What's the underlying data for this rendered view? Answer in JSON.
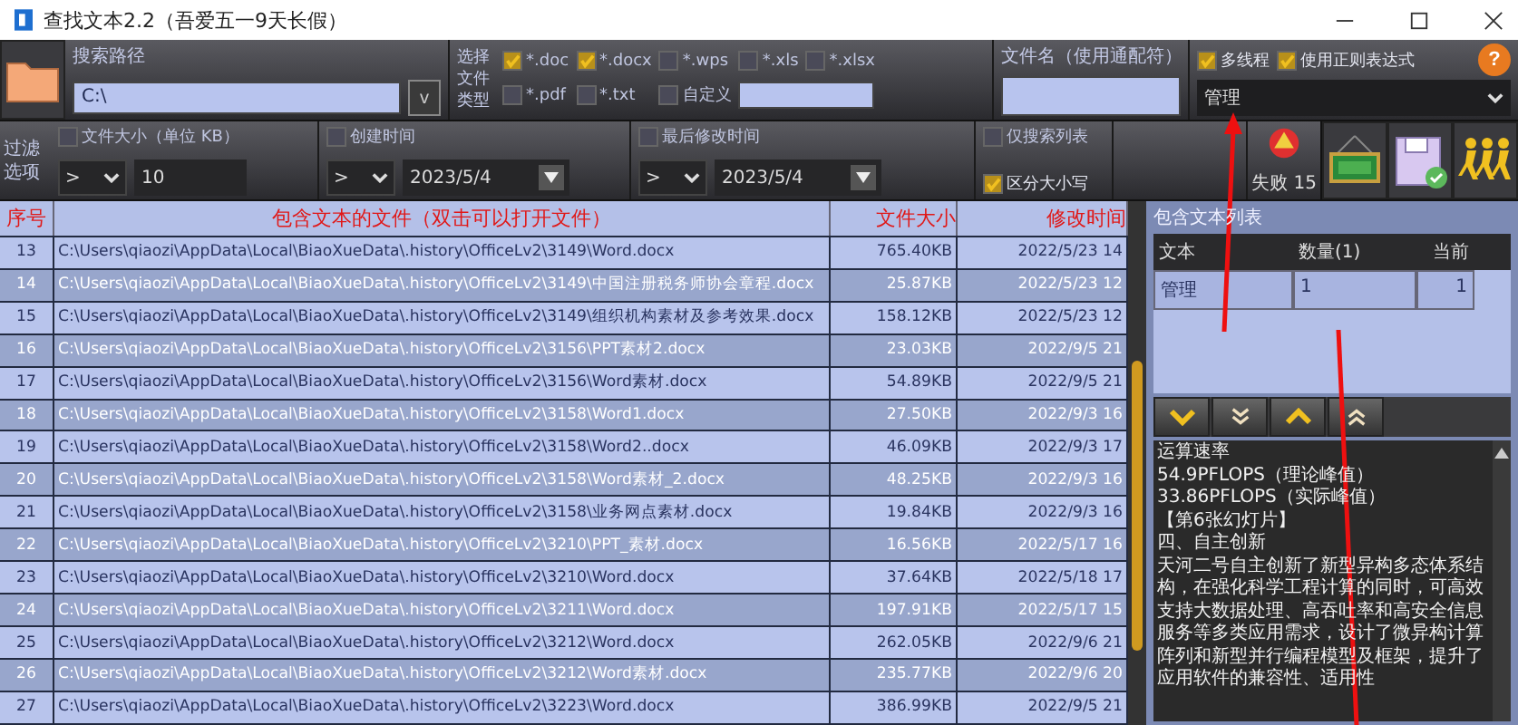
{
  "window": {
    "title": "查找文本2.2（吾爱五一9天长假）"
  },
  "search_path": {
    "label": "搜索路径",
    "value": "C:\\",
    "dropdown": "v"
  },
  "file_types": {
    "label": "选择文件类型",
    "options": [
      {
        "label": "*.doc",
        "checked": true
      },
      {
        "label": "*.docx",
        "checked": true
      },
      {
        "label": "*.wps",
        "checked": false
      },
      {
        "label": "*.xls",
        "checked": false
      },
      {
        "label": "*.xlsx",
        "checked": false
      },
      {
        "label": "*.pdf",
        "checked": false
      },
      {
        "label": "*.txt",
        "checked": false
      },
      {
        "label": "自定义",
        "checked": false
      }
    ]
  },
  "file_name": {
    "label": "文件名（使用通配符）"
  },
  "help_button": "?",
  "options": [
    {
      "label": "多线程",
      "checked": true
    },
    {
      "label": "使用正则表达式",
      "checked": true
    }
  ],
  "keyword_select": {
    "value": "管理"
  },
  "filter_label": "过滤选项",
  "filters": [
    {
      "kind": "number",
      "label": "文件大小（单位 KB）",
      "checked": false,
      "operator": ">",
      "value": "10"
    },
    {
      "kind": "date",
      "label": "创建时间",
      "checked": false,
      "operator": ">",
      "value": "2023/5/4"
    },
    {
      "kind": "date",
      "label": "最后修改时间",
      "checked": false,
      "operator": ">",
      "value": "2023/5/4"
    }
  ],
  "search_options": [
    {
      "label": "仅搜索列表",
      "checked": false
    },
    {
      "label": "区分大小写",
      "checked": true
    }
  ],
  "failures": "失败 15",
  "table": {
    "columns": [
      "序号",
      "包含文本的文件（双击可以打开文件）",
      "文件大小",
      "修改时间"
    ],
    "rows": [
      [
        "13",
        "C:\\Users\\qiaozi\\AppData\\Local\\BiaoXueData\\.history\\OfficeLv2\\3149\\Word.docx",
        "765.40KB",
        "2022/5/23 14"
      ],
      [
        "14",
        "C:\\Users\\qiaozi\\AppData\\Local\\BiaoXueData\\.history\\OfficeLv2\\3149\\中国注册税务师协会章程.docx",
        "25.87KB",
        "2022/5/23 12"
      ],
      [
        "15",
        "C:\\Users\\qiaozi\\AppData\\Local\\BiaoXueData\\.history\\OfficeLv2\\3149\\组织机构素材及参考效果.docx",
        "158.12KB",
        "2022/5/23 12"
      ],
      [
        "16",
        "C:\\Users\\qiaozi\\AppData\\Local\\BiaoXueData\\.history\\OfficeLv2\\3156\\PPT素材2.docx",
        "23.03KB",
        "2022/9/5 21"
      ],
      [
        "17",
        "C:\\Users\\qiaozi\\AppData\\Local\\BiaoXueData\\.history\\OfficeLv2\\3156\\Word素材.docx",
        "54.89KB",
        "2022/9/5 21"
      ],
      [
        "18",
        "C:\\Users\\qiaozi\\AppData\\Local\\BiaoXueData\\.history\\OfficeLv2\\3158\\Word1.docx",
        "27.50KB",
        "2022/9/3 16"
      ],
      [
        "19",
        "C:\\Users\\qiaozi\\AppData\\Local\\BiaoXueData\\.history\\OfficeLv2\\3158\\Word2..docx",
        "46.09KB",
        "2022/9/3 17"
      ],
      [
        "20",
        "C:\\Users\\qiaozi\\AppData\\Local\\BiaoXueData\\.history\\OfficeLv2\\3158\\Word素材_2.docx",
        "48.25KB",
        "2022/9/3 16"
      ],
      [
        "21",
        "C:\\Users\\qiaozi\\AppData\\Local\\BiaoXueData\\.history\\OfficeLv2\\3158\\业务网点素材.docx",
        "19.84KB",
        "2022/9/3 16"
      ],
      [
        "22",
        "C:\\Users\\qiaozi\\AppData\\Local\\BiaoXueData\\.history\\OfficeLv2\\3210\\PPT_素材.docx",
        "16.56KB",
        "2022/5/17 16"
      ],
      [
        "23",
        "C:\\Users\\qiaozi\\AppData\\Local\\BiaoXueData\\.history\\OfficeLv2\\3210\\Word.docx",
        "37.64KB",
        "2022/5/18 17"
      ],
      [
        "24",
        "C:\\Users\\qiaozi\\AppData\\Local\\BiaoXueData\\.history\\OfficeLv2\\3211\\Word.docx",
        "197.91KB",
        "2022/5/17 15"
      ],
      [
        "25",
        "C:\\Users\\qiaozi\\AppData\\Local\\BiaoXueData\\.history\\OfficeLv2\\3212\\Word.docx",
        "262.05KB",
        "2022/9/6 21"
      ],
      [
        "26",
        "C:\\Users\\qiaozi\\AppData\\Local\\BiaoXueData\\.history\\OfficeLv2\\3212\\Word素材.docx",
        "235.77KB",
        "2022/9/6 20"
      ],
      [
        "27",
        "C:\\Users\\qiaozi\\AppData\\Local\\BiaoXueData\\.history\\OfficeLv2\\3223\\Word.docx",
        "386.99KB",
        "2022/9/5 21"
      ]
    ]
  },
  "text_list": {
    "label": "包含文本列表",
    "columns": [
      "文本",
      "数量(1)",
      "当前"
    ],
    "rows": [
      [
        "管理",
        "1",
        "1"
      ]
    ]
  },
  "preview": [
    "运算速率",
    "54.9PFLOPS（理论峰值）",
    "33.86PFLOPS（实际峰值）",
    "【第6张幻灯片】",
    "四、自主创新",
    "天河二号自主创新了新型异构多态体系结构，在强化科学工程计算的同时，可高效支持大数据处理、高吞吐率和高安全信息服务等多类应用需求，设计了微异构计算阵列和新型并行编程模型及框架，提升了应用软件的兼容性、适用性"
  ]
}
